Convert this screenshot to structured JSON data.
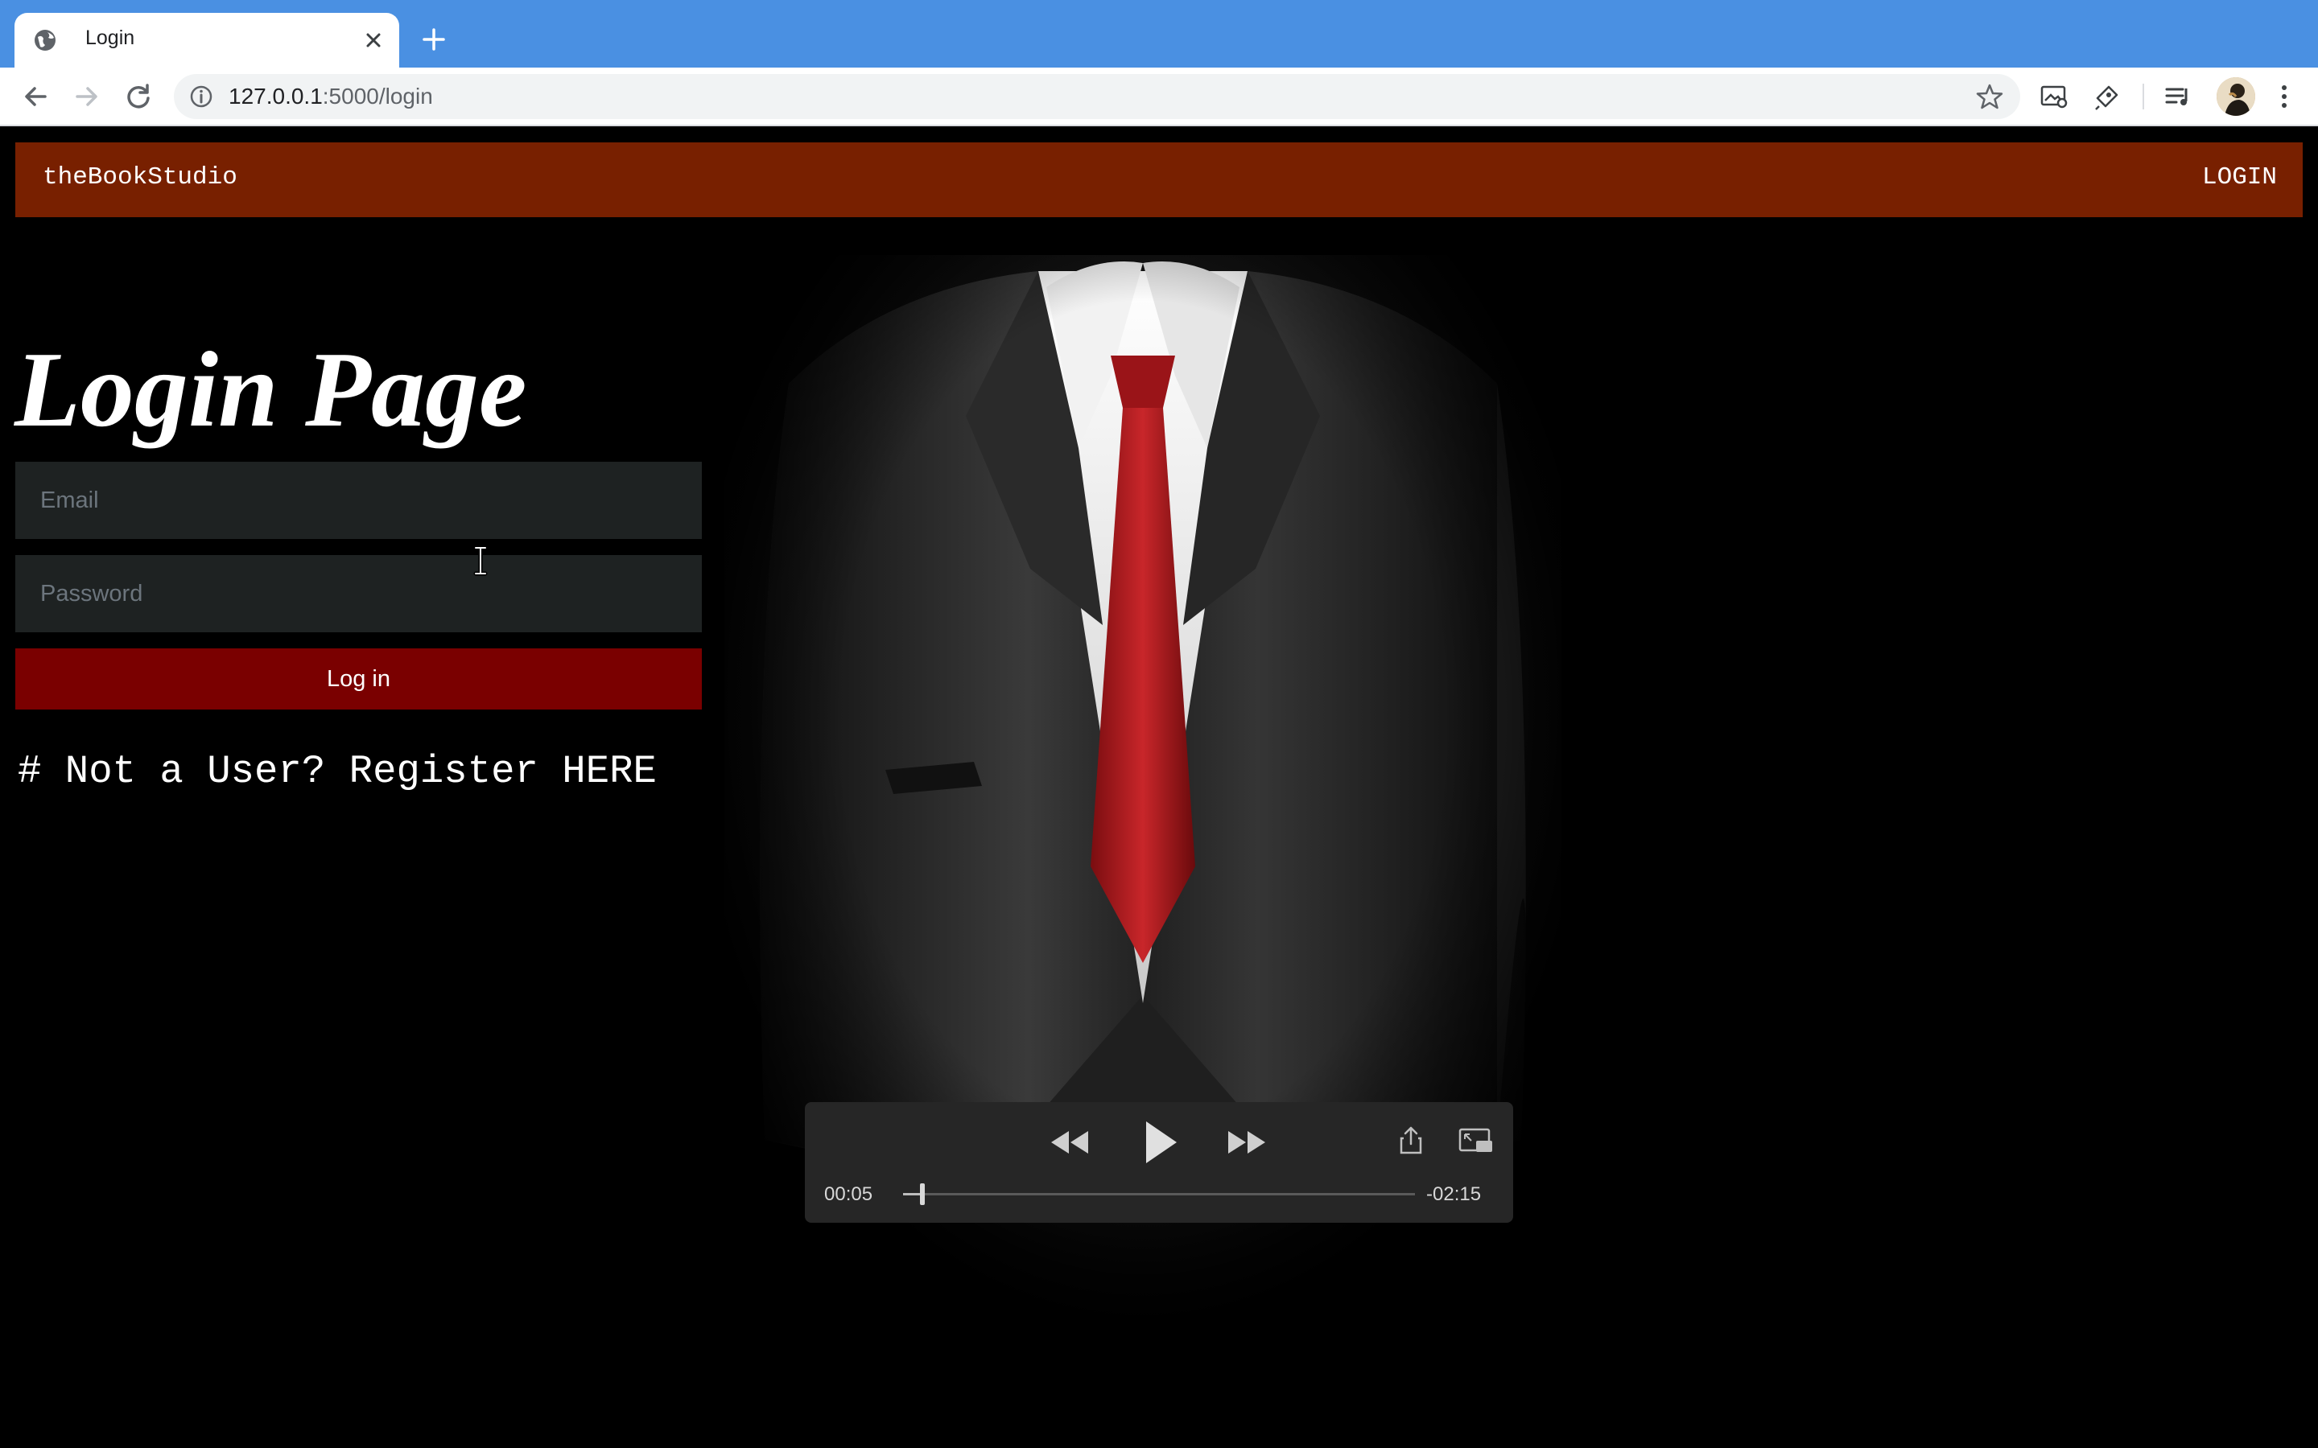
{
  "browser": {
    "tab_title": "Login",
    "url_host": "127.0.0.1",
    "url_path": ":5000/login"
  },
  "navbar": {
    "brand": "theBookStudio",
    "login_link": "LOGIN"
  },
  "login": {
    "heading": "Login Page",
    "email_placeholder": "Email",
    "password_placeholder": "Password",
    "submit_label": "Log in",
    "register_text": "# Not a User? Register HERE"
  },
  "media": {
    "elapsed": "00:05",
    "remaining": "-02:15",
    "progress_fraction": 0.037
  },
  "colors": {
    "tabbar": "#4a90e2",
    "navbar": "#782000",
    "login_button": "#7a0000",
    "input_bg": "#1e2222"
  },
  "icons": [
    "globe-icon",
    "close-icon",
    "plus-icon",
    "back-icon",
    "forward-icon",
    "reload-icon",
    "info-icon",
    "star-icon",
    "rewind-icon",
    "play-icon",
    "fast-forward-icon",
    "share-icon",
    "picture-in-picture-icon"
  ]
}
